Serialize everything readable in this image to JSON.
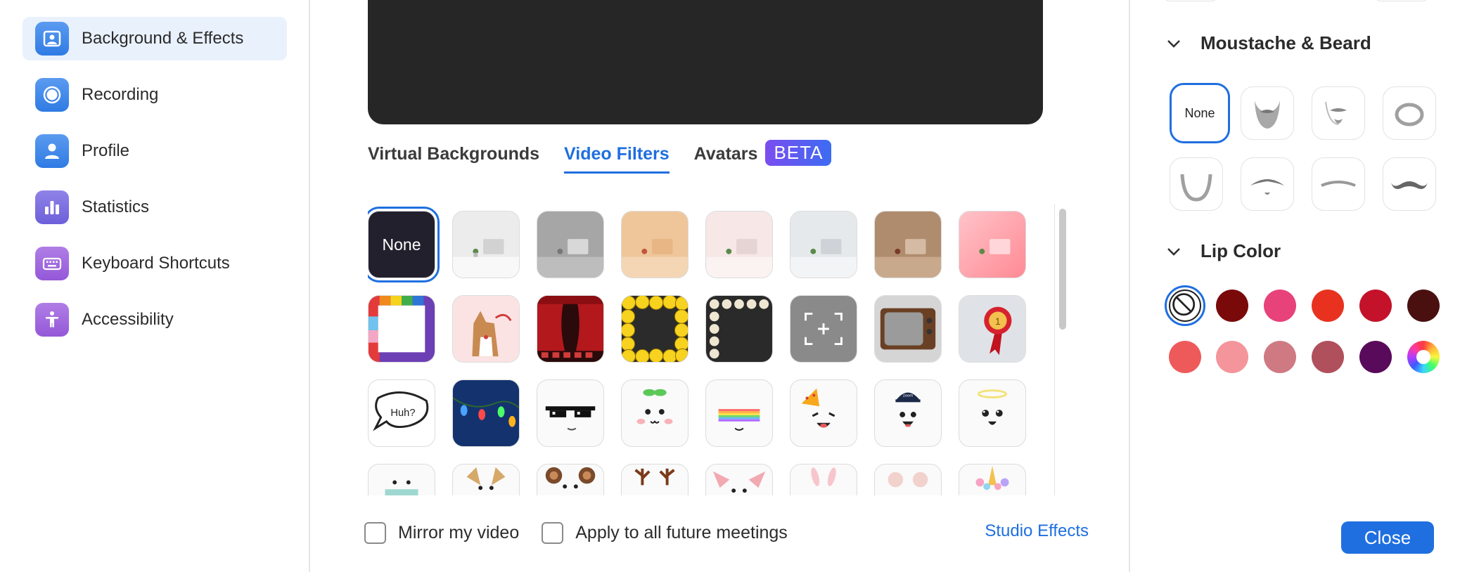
{
  "sidebar": {
    "items": [
      {
        "label": "Background & Effects",
        "icon": "background-effects-icon",
        "active": true
      },
      {
        "label": "Recording",
        "icon": "recording-icon",
        "active": false
      },
      {
        "label": "Profile",
        "icon": "profile-icon",
        "active": false
      },
      {
        "label": "Statistics",
        "icon": "statistics-icon",
        "active": false
      },
      {
        "label": "Keyboard Shortcuts",
        "icon": "keyboard-icon",
        "active": false
      },
      {
        "label": "Accessibility",
        "icon": "accessibility-icon",
        "active": false
      }
    ]
  },
  "main": {
    "tabs": [
      {
        "label": "Virtual Backgrounds",
        "active": false
      },
      {
        "label": "Video Filters",
        "active": true
      },
      {
        "label": "Avatars",
        "active": false
      }
    ],
    "beta_badge": "BETA",
    "filters": {
      "none_label": "None",
      "items": [
        "none",
        "white-room",
        "gray-room",
        "beige-room",
        "pink-light-room",
        "light-gray-room",
        "brown-room",
        "pink-gradient-room",
        "rainbow-frame",
        "corgi-sticker",
        "theater-curtain",
        "emoji-frame",
        "bulb-frame",
        "camera-focus-frame",
        "retro-tv",
        "award-ribbon",
        "speech-bubble-huh",
        "holiday-lights",
        "pixel-sunglasses",
        "sprout-face",
        "rainbow-halo",
        "party-hat-face",
        "zoom-cap-face",
        "angel-halo-face",
        "face-mask",
        "dog-ears",
        "bear-ears",
        "reindeer-antlers",
        "pig-ears",
        "bunny-ears",
        "mouse-ears",
        "unicorn-horn"
      ],
      "speech_text": "Huh?"
    },
    "footer": {
      "mirror_label": "Mirror my video",
      "apply_label": "Apply to all future meetings",
      "studio_effects": "Studio Effects"
    }
  },
  "right_panel": {
    "moustache_title": "Moustache & Beard",
    "beard_none": "None",
    "beards": [
      "none",
      "full-beard",
      "goatee",
      "circle-beard",
      "chin-strap",
      "walrus-moustache",
      "thin-moustache",
      "handlebar-moustache"
    ],
    "lip_title": "Lip Color",
    "lip_colors": [
      "none",
      "#7a0a0a",
      "#e8427a",
      "#e8321f",
      "#c4122a",
      "#4a1010",
      "#ee5a5a",
      "#f3959b",
      "#cf7a82",
      "#b0505c",
      "#5a0a5a",
      "rainbow"
    ],
    "close_label": "Close"
  }
}
